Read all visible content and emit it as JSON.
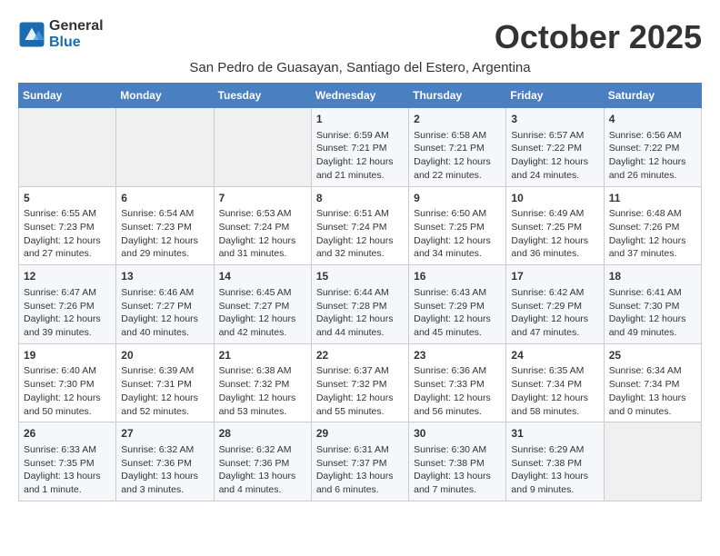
{
  "logo": {
    "general": "General",
    "blue": "Blue"
  },
  "title": "October 2025",
  "subtitle": "San Pedro de Guasayan, Santiago del Estero, Argentina",
  "days_header": [
    "Sunday",
    "Monday",
    "Tuesday",
    "Wednesday",
    "Thursday",
    "Friday",
    "Saturday"
  ],
  "weeks": [
    [
      {
        "day": "",
        "content": ""
      },
      {
        "day": "",
        "content": ""
      },
      {
        "day": "",
        "content": ""
      },
      {
        "day": "1",
        "content": "Sunrise: 6:59 AM\nSunset: 7:21 PM\nDaylight: 12 hours\nand 21 minutes."
      },
      {
        "day": "2",
        "content": "Sunrise: 6:58 AM\nSunset: 7:21 PM\nDaylight: 12 hours\nand 22 minutes."
      },
      {
        "day": "3",
        "content": "Sunrise: 6:57 AM\nSunset: 7:22 PM\nDaylight: 12 hours\nand 24 minutes."
      },
      {
        "day": "4",
        "content": "Sunrise: 6:56 AM\nSunset: 7:22 PM\nDaylight: 12 hours\nand 26 minutes."
      }
    ],
    [
      {
        "day": "5",
        "content": "Sunrise: 6:55 AM\nSunset: 7:23 PM\nDaylight: 12 hours\nand 27 minutes."
      },
      {
        "day": "6",
        "content": "Sunrise: 6:54 AM\nSunset: 7:23 PM\nDaylight: 12 hours\nand 29 minutes."
      },
      {
        "day": "7",
        "content": "Sunrise: 6:53 AM\nSunset: 7:24 PM\nDaylight: 12 hours\nand 31 minutes."
      },
      {
        "day": "8",
        "content": "Sunrise: 6:51 AM\nSunset: 7:24 PM\nDaylight: 12 hours\nand 32 minutes."
      },
      {
        "day": "9",
        "content": "Sunrise: 6:50 AM\nSunset: 7:25 PM\nDaylight: 12 hours\nand 34 minutes."
      },
      {
        "day": "10",
        "content": "Sunrise: 6:49 AM\nSunset: 7:25 PM\nDaylight: 12 hours\nand 36 minutes."
      },
      {
        "day": "11",
        "content": "Sunrise: 6:48 AM\nSunset: 7:26 PM\nDaylight: 12 hours\nand 37 minutes."
      }
    ],
    [
      {
        "day": "12",
        "content": "Sunrise: 6:47 AM\nSunset: 7:26 PM\nDaylight: 12 hours\nand 39 minutes."
      },
      {
        "day": "13",
        "content": "Sunrise: 6:46 AM\nSunset: 7:27 PM\nDaylight: 12 hours\nand 40 minutes."
      },
      {
        "day": "14",
        "content": "Sunrise: 6:45 AM\nSunset: 7:27 PM\nDaylight: 12 hours\nand 42 minutes."
      },
      {
        "day": "15",
        "content": "Sunrise: 6:44 AM\nSunset: 7:28 PM\nDaylight: 12 hours\nand 44 minutes."
      },
      {
        "day": "16",
        "content": "Sunrise: 6:43 AM\nSunset: 7:29 PM\nDaylight: 12 hours\nand 45 minutes."
      },
      {
        "day": "17",
        "content": "Sunrise: 6:42 AM\nSunset: 7:29 PM\nDaylight: 12 hours\nand 47 minutes."
      },
      {
        "day": "18",
        "content": "Sunrise: 6:41 AM\nSunset: 7:30 PM\nDaylight: 12 hours\nand 49 minutes."
      }
    ],
    [
      {
        "day": "19",
        "content": "Sunrise: 6:40 AM\nSunset: 7:30 PM\nDaylight: 12 hours\nand 50 minutes."
      },
      {
        "day": "20",
        "content": "Sunrise: 6:39 AM\nSunset: 7:31 PM\nDaylight: 12 hours\nand 52 minutes."
      },
      {
        "day": "21",
        "content": "Sunrise: 6:38 AM\nSunset: 7:32 PM\nDaylight: 12 hours\nand 53 minutes."
      },
      {
        "day": "22",
        "content": "Sunrise: 6:37 AM\nSunset: 7:32 PM\nDaylight: 12 hours\nand 55 minutes."
      },
      {
        "day": "23",
        "content": "Sunrise: 6:36 AM\nSunset: 7:33 PM\nDaylight: 12 hours\nand 56 minutes."
      },
      {
        "day": "24",
        "content": "Sunrise: 6:35 AM\nSunset: 7:34 PM\nDaylight: 12 hours\nand 58 minutes."
      },
      {
        "day": "25",
        "content": "Sunrise: 6:34 AM\nSunset: 7:34 PM\nDaylight: 13 hours\nand 0 minutes."
      }
    ],
    [
      {
        "day": "26",
        "content": "Sunrise: 6:33 AM\nSunset: 7:35 PM\nDaylight: 13 hours\nand 1 minute."
      },
      {
        "day": "27",
        "content": "Sunrise: 6:32 AM\nSunset: 7:36 PM\nDaylight: 13 hours\nand 3 minutes."
      },
      {
        "day": "28",
        "content": "Sunrise: 6:32 AM\nSunset: 7:36 PM\nDaylight: 13 hours\nand 4 minutes."
      },
      {
        "day": "29",
        "content": "Sunrise: 6:31 AM\nSunset: 7:37 PM\nDaylight: 13 hours\nand 6 minutes."
      },
      {
        "day": "30",
        "content": "Sunrise: 6:30 AM\nSunset: 7:38 PM\nDaylight: 13 hours\nand 7 minutes."
      },
      {
        "day": "31",
        "content": "Sunrise: 6:29 AM\nSunset: 7:38 PM\nDaylight: 13 hours\nand 9 minutes."
      },
      {
        "day": "",
        "content": ""
      }
    ]
  ]
}
